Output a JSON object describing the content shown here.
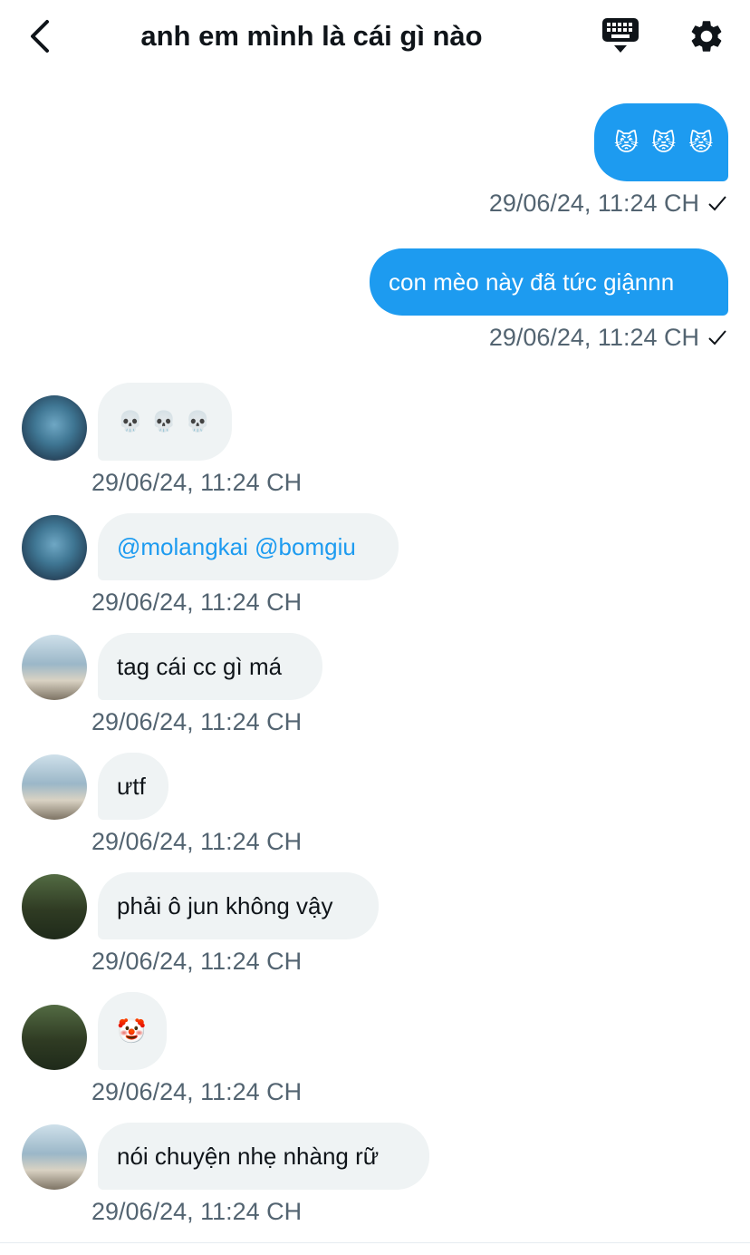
{
  "header": {
    "title": "anh em mình là cái gì nào",
    "back_icon": "chevron-left-icon",
    "keyboard_icon": "keyboard-icon",
    "settings_icon": "gear-icon"
  },
  "colors": {
    "accent": "#1d9bf0",
    "incoming_bubble": "#eff3f4",
    "timestamp": "#536471"
  },
  "messages": [
    {
      "direction": "out",
      "emoji": [
        "😾",
        "😾",
        "😾"
      ],
      "time": "29/06/24, 11:24 CH",
      "status_icon": "check-icon"
    },
    {
      "direction": "out",
      "text": "con mèo này đã tức giậnnn",
      "time": "29/06/24, 11:24 CH",
      "status_icon": "check-icon"
    },
    {
      "direction": "in",
      "emoji": [
        "💀",
        "💀",
        "💀"
      ],
      "time": "29/06/24, 11:24 CH"
    },
    {
      "direction": "in",
      "mentions": [
        "@molangkai",
        "@bomgiu"
      ],
      "time": "29/06/24, 11:24 CH"
    },
    {
      "direction": "in",
      "text": "tag cái cc gì má",
      "time": "29/06/24, 11:24 CH"
    },
    {
      "direction": "in",
      "text": "ưtf",
      "time": "29/06/24, 11:24 CH"
    },
    {
      "direction": "in",
      "text": "phải ô jun không vậy",
      "time": "29/06/24, 11:24 CH"
    },
    {
      "direction": "in",
      "emoji": [
        "🤡"
      ],
      "time": "29/06/24, 11:24 CH"
    },
    {
      "direction": "in",
      "text": "nói chuyện nhẹ nhàng rữ",
      "time": "29/06/24, 11:24 CH"
    }
  ]
}
